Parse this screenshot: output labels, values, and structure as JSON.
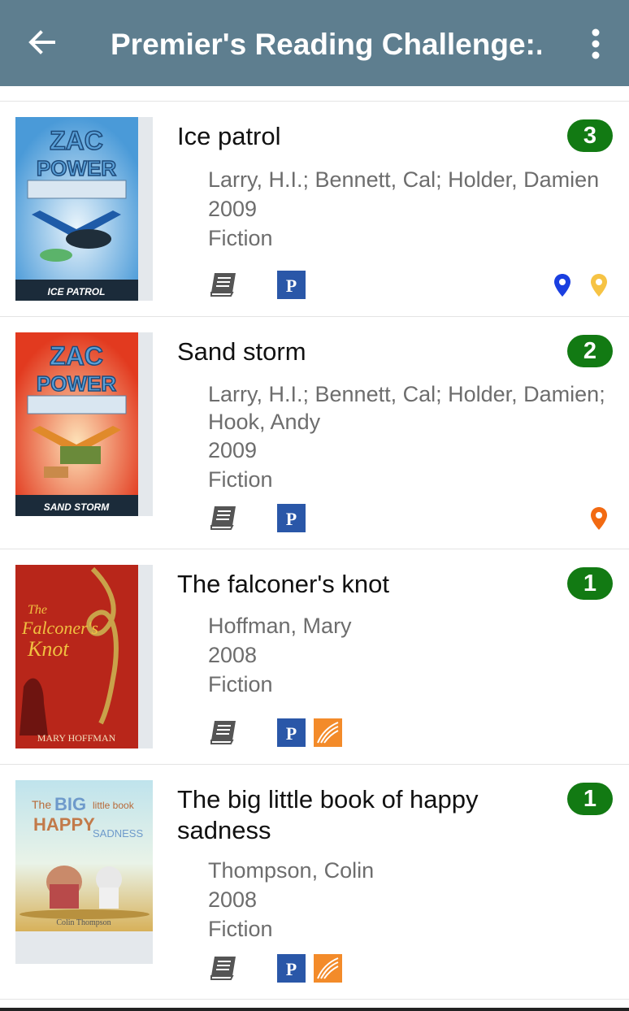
{
  "appbar": {
    "title": "Premier's Reading Challenge:...",
    "back_icon": "arrow-back-icon",
    "menu_icon": "more-vert-icon"
  },
  "colors": {
    "appbar": "#5e7e8f",
    "badge": "#127a13",
    "pin_blue": "#1a3fe0",
    "pin_yellow": "#f6c344",
    "pin_orange": "#f26a12",
    "prc_blue": "#2a57a8",
    "ebook_orange": "#f38b2a"
  },
  "items": [
    {
      "title": "Ice patrol",
      "authors": "Larry, H.I.; Bennett, Cal; Holder, Damien",
      "year": "2009",
      "genre": "Fiction",
      "count": "3",
      "cover_title": "ZAC POWER",
      "cover_subtitle": "ICE PATROL",
      "prc_letter": "P"
    },
    {
      "title": "Sand storm",
      "authors": "Larry, H.I.; Bennett, Cal; Holder, Damien; Hook, Andy",
      "year": "2009",
      "genre": "Fiction",
      "count": "2",
      "cover_title": "ZAC POWER",
      "cover_subtitle": "SAND STORM",
      "prc_letter": "P"
    },
    {
      "title": "The falconer's knot",
      "authors": "Hoffman, Mary",
      "year": "2008",
      "genre": "Fiction",
      "count": "1",
      "cover_title": "The Falconer's Knot",
      "cover_subtitle": "MARY HOFFMAN",
      "prc_letter": "P"
    },
    {
      "title": "The big little book of happy sadness",
      "authors": "Thompson, Colin",
      "year": "2008",
      "genre": "Fiction",
      "count": "1",
      "cover_title": "The BIG little book of HAPPY SADNESS",
      "cover_subtitle": "Colin Thompson",
      "prc_letter": "P"
    }
  ]
}
